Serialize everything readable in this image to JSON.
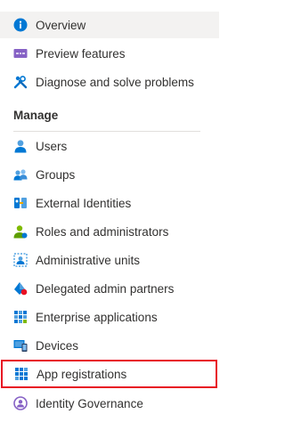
{
  "nav": {
    "top_items": [
      {
        "label": "Overview",
        "icon": "info-icon",
        "selected": true
      },
      {
        "label": "Preview features",
        "icon": "preview-features-icon"
      },
      {
        "label": "Diagnose and solve problems",
        "icon": "wrench-icon"
      }
    ],
    "section_title": "Manage",
    "manage_items": [
      {
        "label": "Users",
        "icon": "user-icon"
      },
      {
        "label": "Groups",
        "icon": "groups-icon"
      },
      {
        "label": "External Identities",
        "icon": "external-identities-icon"
      },
      {
        "label": "Roles and administrators",
        "icon": "roles-icon"
      },
      {
        "label": "Administrative units",
        "icon": "admin-units-icon"
      },
      {
        "label": "Delegated admin partners",
        "icon": "delegated-partners-icon"
      },
      {
        "label": "Enterprise applications",
        "icon": "enterprise-apps-icon"
      },
      {
        "label": "Devices",
        "icon": "devices-icon"
      },
      {
        "label": "App registrations",
        "icon": "app-registrations-icon",
        "highlighted": true
      },
      {
        "label": "Identity Governance",
        "icon": "identity-governance-icon"
      }
    ]
  },
  "colors": {
    "accent": "#0078d4",
    "highlight_border": "#e81123",
    "selected_bg": "#f3f2f1"
  }
}
